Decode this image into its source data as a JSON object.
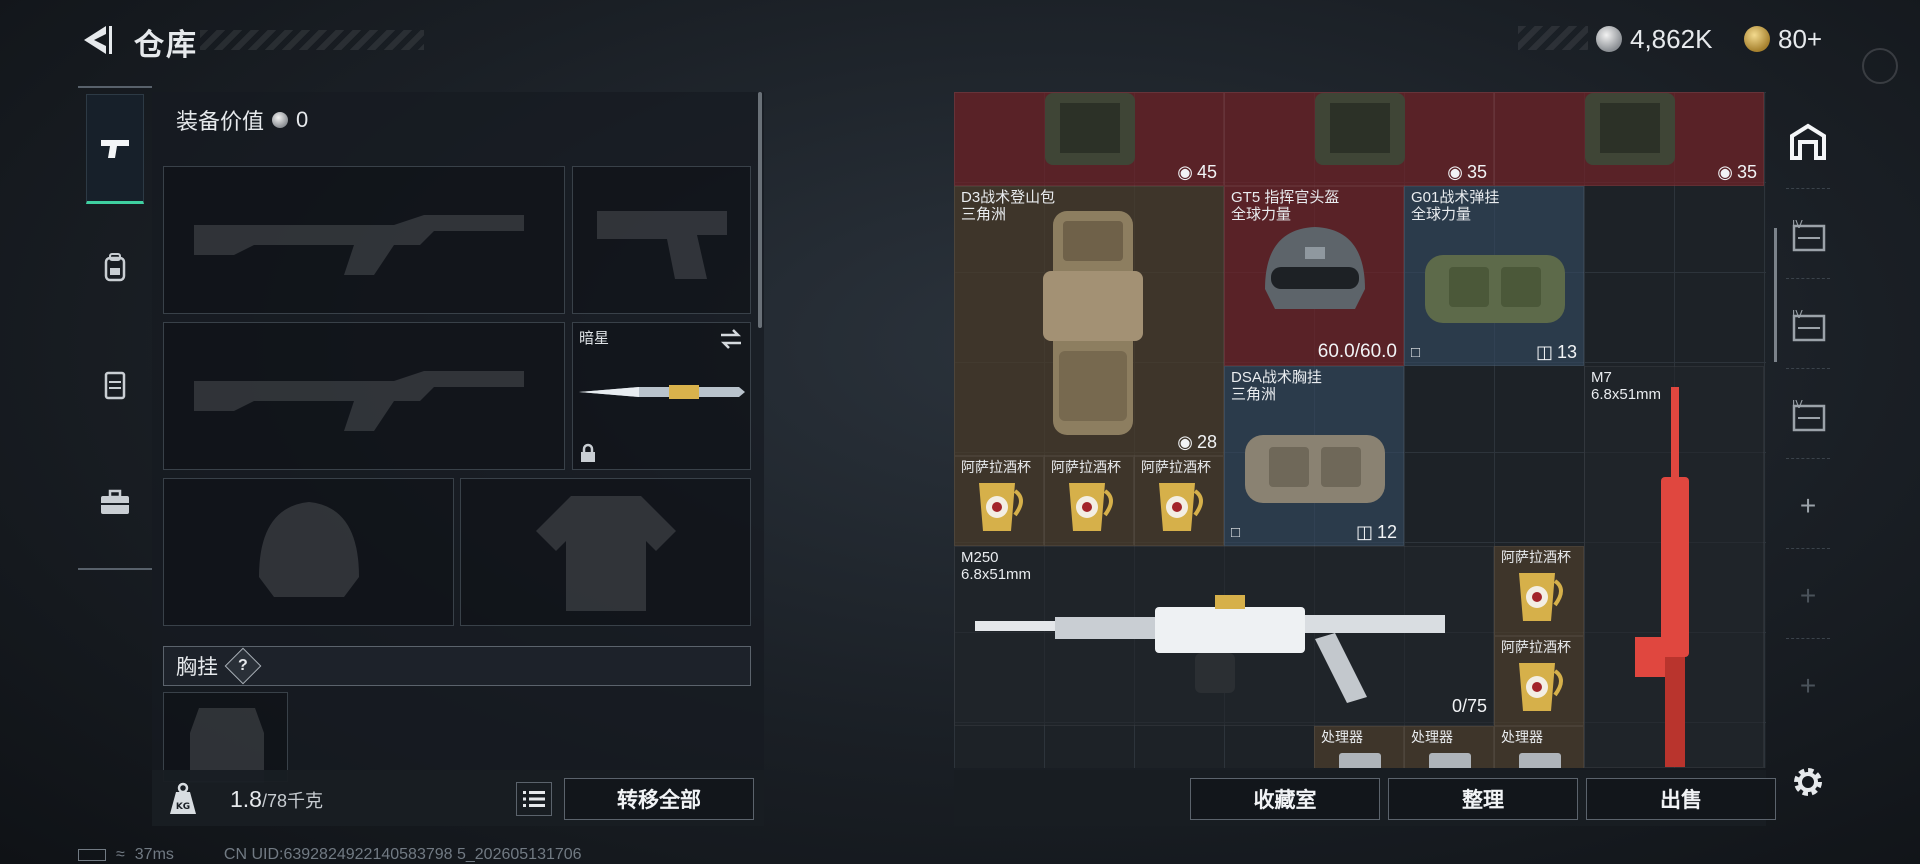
{
  "header": {
    "title": "仓库",
    "currency_silver": "4,862K",
    "currency_gold": "80+"
  },
  "loadout": {
    "equip_value_label": "装备价值",
    "equip_value": "0",
    "melee_name": "暗星",
    "vest_label": "胸挂",
    "vest_help": "?",
    "weight_current": "1.8",
    "weight_max": "/78千克",
    "transfer_all": "转移全部"
  },
  "storage": {
    "top_row_counts": [
      "45",
      "35",
      "35"
    ],
    "items": {
      "backpack": {
        "name": "D3战术登山包",
        "sub": "三角洲",
        "count": "28"
      },
      "helmet": {
        "name": "GT5 指挥官头盔",
        "sub": "全球力量",
        "durability": "60.0/60.0"
      },
      "rig_g01": {
        "name": "G01战术弹挂",
        "sub": "全球力量",
        "count": "13"
      },
      "rig_dsa": {
        "name": "DSA战术胸挂",
        "sub": "三角洲",
        "count": "12"
      },
      "cups": [
        "阿萨拉酒杯",
        "阿萨拉酒杯",
        "阿萨拉酒杯",
        "阿萨拉酒杯",
        "阿萨拉酒杯"
      ],
      "m7": {
        "name": "M7",
        "sub": "6.8x51mm"
      },
      "m250": {
        "name": "M250",
        "sub": "6.8x51mm",
        "ammo": "0/75"
      },
      "processors": [
        "处理器",
        "处理器",
        "处理器"
      ]
    }
  },
  "bottom_buttons": {
    "collection": "收藏室",
    "organize": "整理",
    "sell": "出售"
  },
  "status_bar": {
    "ping": "37ms",
    "uid": "CN UID:6392824922140583798 5_202605131706"
  },
  "colors": {
    "accent_green": "#3fd0a0",
    "rarity_red": "#702228",
    "rarity_blue": "#344a62",
    "rarity_brown": "#4a3c2c",
    "m7_red": "#e0473f"
  }
}
